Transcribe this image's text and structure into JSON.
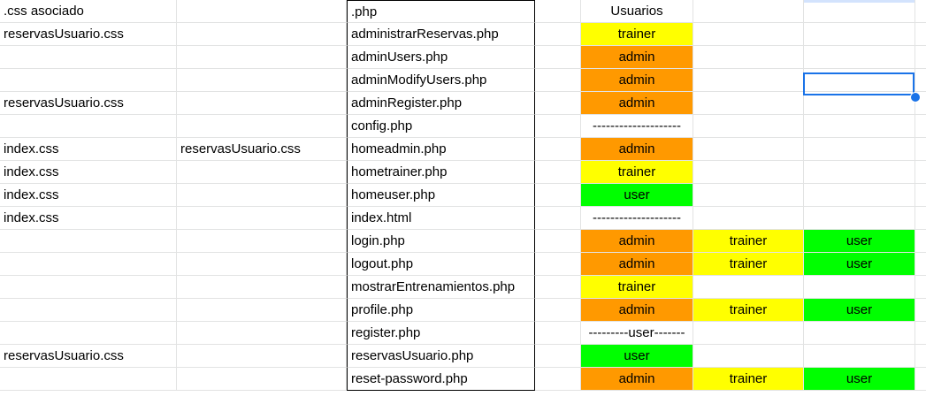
{
  "colors": {
    "admin": "#ff9900",
    "trainer": "#ffff00",
    "user": "#00ff00",
    "selection": "#1a73e8"
  },
  "rows": [
    {
      "a": ".css asociado",
      "b": "",
      "c": ".php",
      "d": {
        "text": "Usuarios",
        "color": ""
      },
      "e": {
        "text": "",
        "color": ""
      },
      "f": {
        "text": "",
        "color": ""
      }
    },
    {
      "a": "reservasUsuario.css",
      "b": "",
      "c": "administrarReservas.php",
      "d": {
        "text": "trainer",
        "color": "trainer"
      },
      "e": {
        "text": "",
        "color": ""
      },
      "f": {
        "text": "",
        "color": ""
      }
    },
    {
      "a": "",
      "b": "",
      "c": "adminUsers.php",
      "d": {
        "text": "admin",
        "color": "admin"
      },
      "e": {
        "text": "",
        "color": ""
      },
      "f": {
        "text": "",
        "color": ""
      }
    },
    {
      "a": "",
      "b": "",
      "c": "adminModifyUsers.php",
      "d": {
        "text": "admin",
        "color": "admin"
      },
      "e": {
        "text": "",
        "color": ""
      },
      "f": {
        "text": "",
        "color": ""
      }
    },
    {
      "a": "reservasUsuario.css",
      "b": "",
      "c": "adminRegister.php",
      "d": {
        "text": "admin",
        "color": "admin"
      },
      "e": {
        "text": "",
        "color": ""
      },
      "f": {
        "text": "",
        "color": ""
      }
    },
    {
      "a": "",
      "b": "",
      "c": "config.php",
      "d": {
        "text": "--------------------",
        "color": ""
      },
      "e": {
        "text": "",
        "color": ""
      },
      "f": {
        "text": "",
        "color": ""
      }
    },
    {
      "a": "index.css",
      "b": "reservasUsuario.css",
      "c": "homeadmin.php",
      "d": {
        "text": "admin",
        "color": "admin"
      },
      "e": {
        "text": "",
        "color": ""
      },
      "f": {
        "text": "",
        "color": ""
      }
    },
    {
      "a": "index.css",
      "b": "",
      "c": "hometrainer.php",
      "d": {
        "text": "trainer",
        "color": "trainer"
      },
      "e": {
        "text": "",
        "color": ""
      },
      "f": {
        "text": "",
        "color": ""
      }
    },
    {
      "a": "index.css",
      "b": "",
      "c": "homeuser.php",
      "d": {
        "text": "user",
        "color": "user"
      },
      "e": {
        "text": "",
        "color": ""
      },
      "f": {
        "text": "",
        "color": ""
      }
    },
    {
      "a": "index.css",
      "b": "",
      "c": "index.html",
      "d": {
        "text": "--------------------",
        "color": ""
      },
      "e": {
        "text": "",
        "color": ""
      },
      "f": {
        "text": "",
        "color": ""
      }
    },
    {
      "a": "",
      "b": "",
      "c": "login.php",
      "d": {
        "text": "admin",
        "color": "admin"
      },
      "e": {
        "text": "trainer",
        "color": "trainer"
      },
      "f": {
        "text": "user",
        "color": "user"
      }
    },
    {
      "a": "",
      "b": "",
      "c": "logout.php",
      "d": {
        "text": "admin",
        "color": "admin"
      },
      "e": {
        "text": "trainer",
        "color": "trainer"
      },
      "f": {
        "text": "user",
        "color": "user"
      }
    },
    {
      "a": "",
      "b": "",
      "c": "mostrarEntrenamientos.php",
      "d": {
        "text": "trainer",
        "color": "trainer"
      },
      "e": {
        "text": "",
        "color": ""
      },
      "f": {
        "text": "",
        "color": ""
      }
    },
    {
      "a": "",
      "b": "",
      "c": "profile.php",
      "d": {
        "text": "admin",
        "color": "admin"
      },
      "e": {
        "text": "trainer",
        "color": "trainer"
      },
      "f": {
        "text": "user",
        "color": "user"
      }
    },
    {
      "a": "",
      "b": "",
      "c": "register.php",
      "d": {
        "text": "---------user-------",
        "color": ""
      },
      "e": {
        "text": "",
        "color": ""
      },
      "f": {
        "text": "",
        "color": ""
      }
    },
    {
      "a": "reservasUsuario.css",
      "b": "",
      "c": "reservasUsuario.php",
      "d": {
        "text": "user",
        "color": "user"
      },
      "e": {
        "text": "",
        "color": ""
      },
      "f": {
        "text": "",
        "color": ""
      }
    },
    {
      "a": "",
      "b": "",
      "c": "reset-password.php",
      "d": {
        "text": "admin",
        "color": "admin"
      },
      "e": {
        "text": "trainer",
        "color": "trainer"
      },
      "f": {
        "text": "user",
        "color": "user"
      }
    }
  ]
}
